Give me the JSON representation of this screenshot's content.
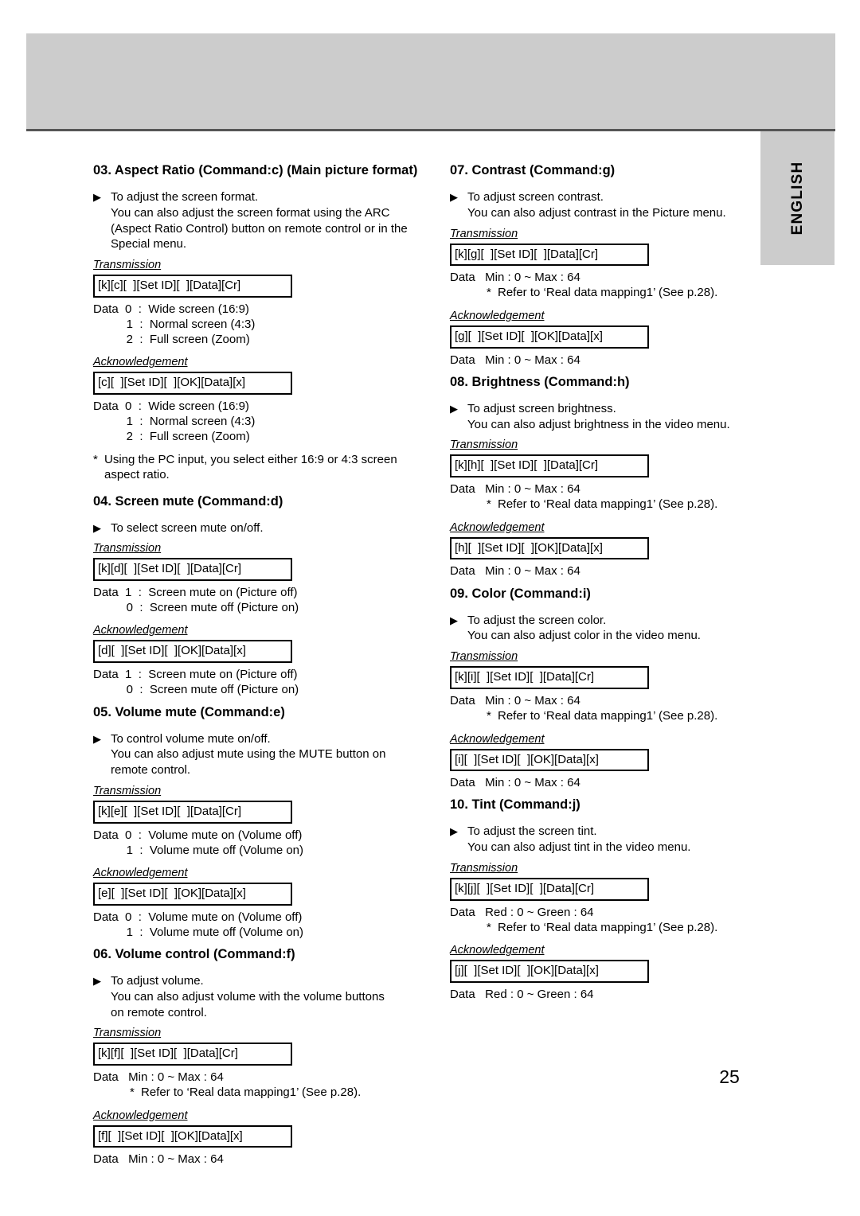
{
  "page": {
    "number": "25",
    "language_tab": "ENGLISH",
    "gray": "#cccccc",
    "rule": "#555555"
  },
  "labels": {
    "transmission": "Transmission",
    "acknowledgement": "Acknowledgement",
    "bullet_glyph": "▶",
    "star_glyph": "*",
    "refer_note": "Refer to ‘Real data mapping1’ (See p.28)."
  },
  "left_column": [
    {
      "id": "aspect-ratio",
      "title": "03. Aspect Ratio (Command:c) (Main picture format)",
      "title_wraps": false,
      "desc_lines": [
        "To adjust the screen format.",
        "You can also adjust the screen format using the ARC",
        "(Aspect Ratio Control) button on remote control or in the",
        "Special menu."
      ],
      "transmission_cmd": "[k][c][  ][Set ID][  ][Data][Cr]",
      "transmission_data": [
        "Data  0  :  Wide screen (16:9)",
        "          1  :  Normal screen (4:3)",
        "          2  :  Full screen (Zoom)"
      ],
      "transmission_note": [],
      "ack_cmd": "[c][  ][Set ID][  ][OK][Data][x]",
      "ack_data": [
        "Data  0  :  Wide screen (16:9)",
        "          1  :  Normal screen (4:3)",
        "          2  :  Full screen (Zoom)"
      ],
      "ack_note": [],
      "footnote_lines": [
        "Using the PC input, you select either 16:9 or 4:3 screen",
        "aspect ratio."
      ]
    },
    {
      "id": "screen-mute",
      "title": "04. Screen mute (Command:d)",
      "title_wraps": false,
      "desc_lines": [
        "To select screen mute on/off."
      ],
      "transmission_cmd": "[k][d][  ][Set ID][  ][Data][Cr]",
      "transmission_data": [
        "Data  1  :  Screen mute on (Picture off)",
        "          0  :  Screen mute off (Picture on)"
      ],
      "transmission_note": [],
      "ack_cmd": "[d][  ][Set ID][  ][OK][Data][x]",
      "ack_data": [
        "Data  1  :  Screen mute on (Picture off)",
        "          0  :  Screen mute off (Picture on)"
      ],
      "ack_note": [],
      "footnote_lines": []
    },
    {
      "id": "volume-mute",
      "title": "05. Volume mute (Command:e)",
      "title_wraps": false,
      "desc_lines": [
        "To control volume mute on/off.",
        "You can also adjust mute using the MUTE button on",
        "remote control."
      ],
      "transmission_cmd": "[k][e][  ][Set ID][  ][Data][Cr]",
      "transmission_data": [
        "Data  0  :  Volume mute on (Volume off)",
        "          1  :  Volume mute off (Volume on)"
      ],
      "transmission_note": [],
      "ack_cmd": "[e][  ][Set ID][  ][OK][Data][x]",
      "ack_data": [
        "Data  0  :  Volume mute on (Volume off)",
        "          1  :  Volume mute off (Volume on)"
      ],
      "ack_note": [],
      "footnote_lines": []
    },
    {
      "id": "volume-control",
      "title": "06. Volume control (Command:f)",
      "title_wraps": false,
      "desc_lines": [
        "To adjust volume.",
        "You can also adjust volume with the volume buttons",
        "on remote control."
      ],
      "transmission_cmd": "[k][f][  ][Set ID][  ][Data][Cr]",
      "transmission_data": [
        "Data   Min : 0 ~ Max : 64"
      ],
      "transmission_note": [
        "Refer to ‘Real data mapping1’ (See p.28)."
      ],
      "ack_cmd": "[f][  ][Set ID][  ][OK][Data][x]",
      "ack_data": [
        "Data   Min : 0 ~ Max : 64"
      ],
      "ack_note": [],
      "footnote_lines": []
    }
  ],
  "right_column": [
    {
      "id": "contrast",
      "title": "07. Contrast (Command:g)",
      "title_wraps": false,
      "desc_lines": [
        "To adjust screen contrast.",
        "You can also adjust contrast in the Picture menu."
      ],
      "transmission_cmd": "[k][g][  ][Set ID][  ][Data][Cr]",
      "transmission_data": [
        "Data   Min : 0 ~ Max : 64"
      ],
      "transmission_note": [
        "Refer to ‘Real data mapping1’ (See p.28)."
      ],
      "ack_cmd": "[g][  ][Set ID][  ][OK][Data][x]",
      "ack_data": [
        "Data   Min : 0 ~ Max : 64"
      ],
      "ack_note": [],
      "footnote_lines": []
    },
    {
      "id": "brightness",
      "title": "08. Brightness (Command:h)",
      "title_wraps": false,
      "desc_lines": [
        "To adjust screen brightness.",
        "You can also adjust brightness in the video menu."
      ],
      "transmission_cmd": "[k][h][  ][Set ID][  ][Data][Cr]",
      "transmission_data": [
        "Data   Min : 0 ~ Max : 64"
      ],
      "transmission_note": [
        "Refer to ‘Real data mapping1’ (See p.28)."
      ],
      "ack_cmd": "[h][  ][Set ID][  ][OK][Data][x]",
      "ack_data": [
        "Data   Min : 0 ~ Max : 64"
      ],
      "ack_note": [],
      "footnote_lines": []
    },
    {
      "id": "color",
      "title": "09. Color (Command:i)",
      "title_wraps": false,
      "desc_lines": [
        "To adjust the screen color.",
        "You can also adjust color in the video menu."
      ],
      "transmission_cmd": "[k][i][  ][Set ID][  ][Data][Cr]",
      "transmission_data": [
        "Data   Min : 0 ~ Max : 64"
      ],
      "transmission_note": [
        "Refer to ‘Real data mapping1’ (See p.28)."
      ],
      "ack_cmd": "[i][  ][Set ID][  ][OK][Data][x]",
      "ack_data": [
        "Data   Min : 0 ~ Max : 64"
      ],
      "ack_note": [],
      "footnote_lines": []
    },
    {
      "id": "tint",
      "title": "10. Tint (Command:j)",
      "title_wraps": false,
      "desc_lines": [
        "To adjust the screen tint.",
        "You can also adjust tint in the video menu."
      ],
      "transmission_cmd": "[k][j][  ][Set ID][  ][Data][Cr]",
      "transmission_data": [
        "Data   Red : 0 ~ Green : 64"
      ],
      "transmission_note": [
        "Refer to ‘Real data mapping1’ (See p.28)."
      ],
      "ack_cmd": "[j][  ][Set ID][  ][OK][Data][x]",
      "ack_data": [
        "Data   Red : 0 ~ Green : 64"
      ],
      "ack_note": [],
      "footnote_lines": []
    }
  ]
}
